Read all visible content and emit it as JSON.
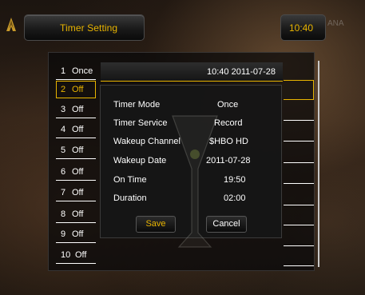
{
  "header": {
    "title": "Timer Setting",
    "clock": "10:40",
    "watermark": "ANA "
  },
  "timer_list": [
    {
      "num": "1",
      "value": "Once"
    },
    {
      "num": "2",
      "value": "Off"
    },
    {
      "num": "3",
      "value": "Off"
    },
    {
      "num": "4",
      "value": "Off"
    },
    {
      "num": "5",
      "value": "Off"
    },
    {
      "num": "6",
      "value": "Off"
    },
    {
      "num": "7",
      "value": "Off"
    },
    {
      "num": "8",
      "value": "Off"
    },
    {
      "num": "9",
      "value": "Off"
    },
    {
      "num": "10",
      "value": "Off"
    }
  ],
  "selected_index": 1,
  "date_header": "10:40 2011-07-28",
  "dialog": {
    "fields": [
      {
        "label": "Timer Mode",
        "value": "Once"
      },
      {
        "label": "Timer Service",
        "value": "Record"
      },
      {
        "label": "Wakeup Channel",
        "value": "$HBO HD"
      },
      {
        "label": "Wakeup Date",
        "value": "2011-07-28"
      },
      {
        "label": "On Time",
        "value": "19:50"
      },
      {
        "label": "Duration",
        "value": "02:00"
      }
    ],
    "save_label": "Save",
    "cancel_label": "Cancel"
  },
  "colors": {
    "accent": "#e8b400",
    "text": "#ffffff",
    "panel": "#161616"
  },
  "icons": {
    "logo": "antenna-logo-icon",
    "background_art": "cocktail-glass-icon"
  }
}
